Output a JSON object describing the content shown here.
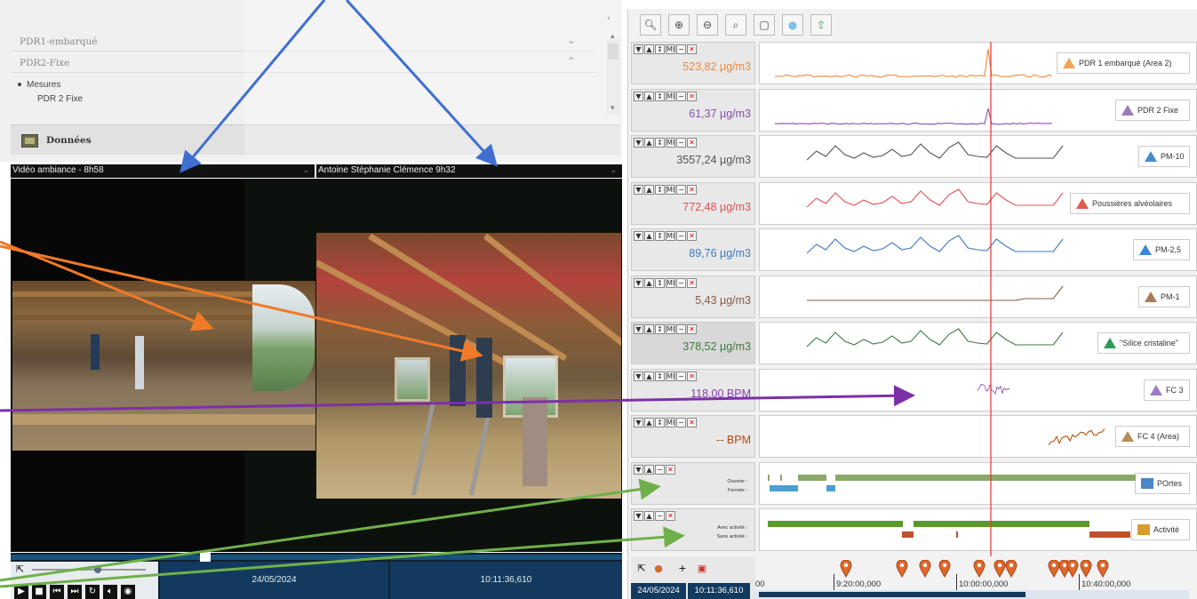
{
  "left": {
    "tree": [
      {
        "label": "PDR1-embarqué"
      },
      {
        "label": "PDR2-Fixe"
      }
    ],
    "mesures_label": "Mesures",
    "mesures_child": "PDR 2 Fixe",
    "donnees_label": "Données"
  },
  "video": {
    "left_title": "Vidéo ambiance - 8h58",
    "right_title": "Antoine Stéphanie Clémence 9h32",
    "date": "24/05/2024",
    "time": "10:11:36,610",
    "control_icons": [
      "play-icon",
      "stop-icon",
      "prev-icon",
      "next-icon",
      "loop-icon",
      "volume-icon",
      "camera-icon"
    ]
  },
  "toolbar_icons": [
    "zoom-icon",
    "zoom-in-icon",
    "zoom-out-icon",
    "zoom-search-icon",
    "screen-icon",
    "comment-icon",
    "export-icon"
  ],
  "tracks": [
    {
      "value": "523,82 µg/m3",
      "color": "#ee8a3c",
      "legend": "PDR 1 embarqué (Area 2)",
      "legend_color": "#f2a55a"
    },
    {
      "value": "61,37 µg/m3",
      "color": "#8a4fb0",
      "legend": "PDR 2 Fixe",
      "legend_color": "#9b7ab8"
    },
    {
      "value": "3557,24 µg/m3",
      "color": "#555555",
      "legend": "PM-10",
      "legend_color": "#4a8cc9"
    },
    {
      "value": "772,48 µg/m3",
      "color": "#e05050",
      "legend": "Poussières alvéolaires",
      "legend_color": "#e25a4c"
    },
    {
      "value": "89,76 µg/m3",
      "color": "#3a7ac0",
      "legend": "PM-2,5",
      "legend_color": "#3b88d8"
    },
    {
      "value": "5,43 µg/m3",
      "color": "#8a5a40",
      "legend": "PM-1",
      "legend_color": "#a77a58"
    },
    {
      "value": "378,52 µg/m3",
      "color": "#3f7a3f",
      "legend": "\"Silice cristaline\"",
      "legend_color": "#2f9a58"
    },
    {
      "value": "118,00 BPM",
      "color": "#8a40b0",
      "legend": "FC 3",
      "legend_color": "#a07ac8"
    },
    {
      "value": "-- BPM",
      "color": "#b45010",
      "legend": "FC 4 (Area)",
      "legend_color": "#b58b58"
    }
  ],
  "state_tracks": [
    {
      "states": [
        "Ouverte :",
        "Fermée :"
      ],
      "legend": "POrtes",
      "legend_color": "#4a86c8"
    },
    {
      "states": [
        "Avec activité :",
        "Sans activité :"
      ],
      "legend": "Activité",
      "legend_color": "#d99c2a"
    }
  ],
  "timeline": {
    "ticks": [
      "9:20:00,000",
      "10:00:00,000",
      "10:40:00,000"
    ],
    "leading_fragment": "00",
    "date": "24/05/2024",
    "time": "10:11:36,610"
  }
}
